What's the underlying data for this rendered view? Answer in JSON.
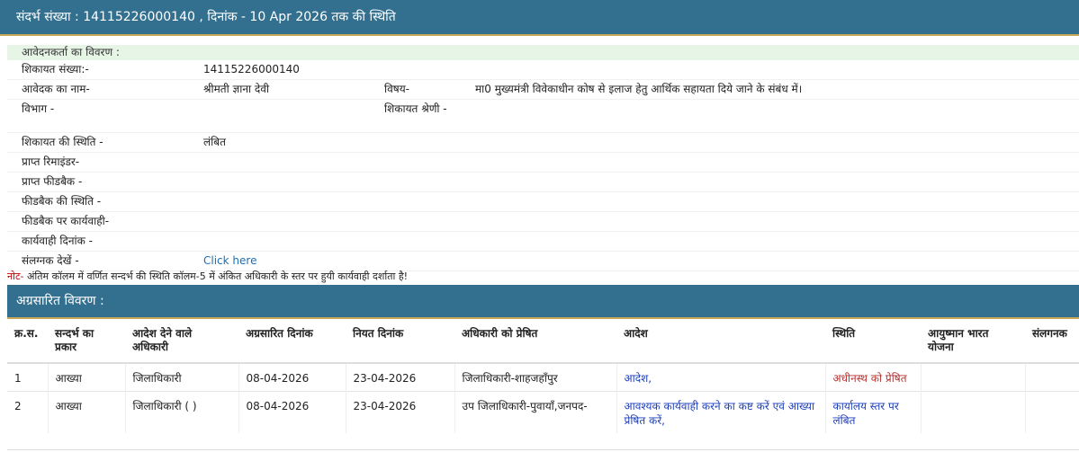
{
  "header": {
    "title": "संदर्भ संख्या : 14115226000140 , दिनांक - 10 Apr 2026 तक की स्थिति"
  },
  "applicant": {
    "section_title": "आवेदनकर्ता का विवरण :",
    "complaint_no_label": "शिकायत संख्या:-",
    "complaint_no": "14115226000140",
    "name_label": "आवेदक का नाम-",
    "name": "श्रीमती ज्ञाना देवी",
    "subject_label": "विषय-",
    "subject": "मा0 मुख्यमंत्री विवेकाधीन कोष से इलाज हेतु आर्थिक सहायता दिये जाने के संबंध में।",
    "department_label": "विभाग -",
    "category_label": "शिकायत श्रेणी -",
    "status_label": "शिकायत की स्थिति -",
    "status": "लंबित",
    "reminder_label": "प्राप्त रिमाइंडर-",
    "feedback_label": "प्राप्त फीडबैक -",
    "feedback_status_label": "फीडबैक की स्थिति -",
    "feedback_action_label": "फीडबैक पर कार्यवाही-",
    "action_date_label": "कार्यवाही दिनांक -",
    "attachment_label": "संलग्नक देखें -",
    "attachment_link": "Click here"
  },
  "note": {
    "prefix": "नोट-",
    "text": " अंतिम कॉलम में वर्णित सन्दर्भ की स्थिति कॉलम-5 में अंकित अधिकारी के स्तर पर हुयी कार्यवाही दर्शाता है!"
  },
  "forwarded": {
    "section_title": "अग्रसारित विवरण :",
    "columns": [
      "क्र.स.",
      "सन्दर्भ का प्रकार",
      "आदेश देने वाले अधिकारी",
      "अग्रसारित दिनांक",
      "नियत दिनांक",
      "अधिकारी को प्रेषित",
      "आदेश",
      "स्थिति",
      "आयुष्मान भारत योजना",
      "संलगनक"
    ],
    "rows": [
      {
        "sno": "1",
        "type": "आख्या",
        "ordering_officer": "जिलाधिकारी",
        "forward_date": "08-04-2026",
        "due_date": "23-04-2026",
        "sent_to": "जिलाधिकारी-शाहजहाँपुर",
        "order": "आदेश,",
        "status": "अधीनस्थ को प्रेषित",
        "ayushman": "",
        "attachment": ""
      },
      {
        "sno": "2",
        "type": "आख्या",
        "ordering_officer": "जिलाधिकारी ( )",
        "forward_date": "08-04-2026",
        "due_date": "23-04-2026",
        "sent_to": "उप जिलाधिकारी-पुवायाँ,जनपद-",
        "order": "आवश्यक कार्यवाही करने का कष्ट करें एवं आख्या प्रेषित करें,",
        "status": "कार्यालय स्तर पर लंबित",
        "ayushman": "",
        "attachment": ""
      }
    ]
  }
}
